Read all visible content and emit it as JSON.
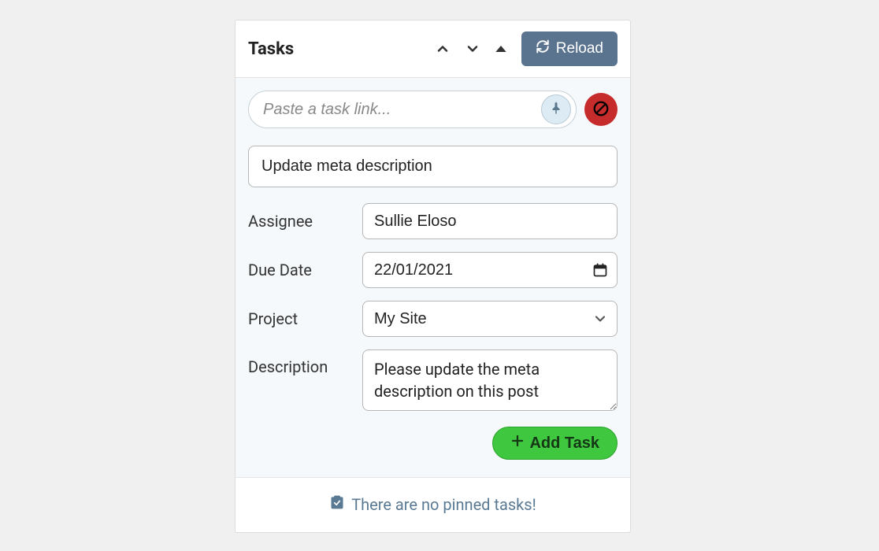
{
  "panel": {
    "title": "Tasks",
    "reload_label": "Reload"
  },
  "link_input": {
    "placeholder": "Paste a task link...",
    "value": ""
  },
  "form": {
    "title_value": "Update meta description",
    "assignee_label": "Assignee",
    "assignee_value": "Sullie Eloso",
    "due_date_label": "Due Date",
    "due_date_value": "22/01/2021",
    "project_label": "Project",
    "project_value": "My Site",
    "description_label": "Description",
    "description_value": "Please update the meta description on this post",
    "add_task_label": "Add Task"
  },
  "footer": {
    "empty_text": "There are no pinned tasks!"
  }
}
